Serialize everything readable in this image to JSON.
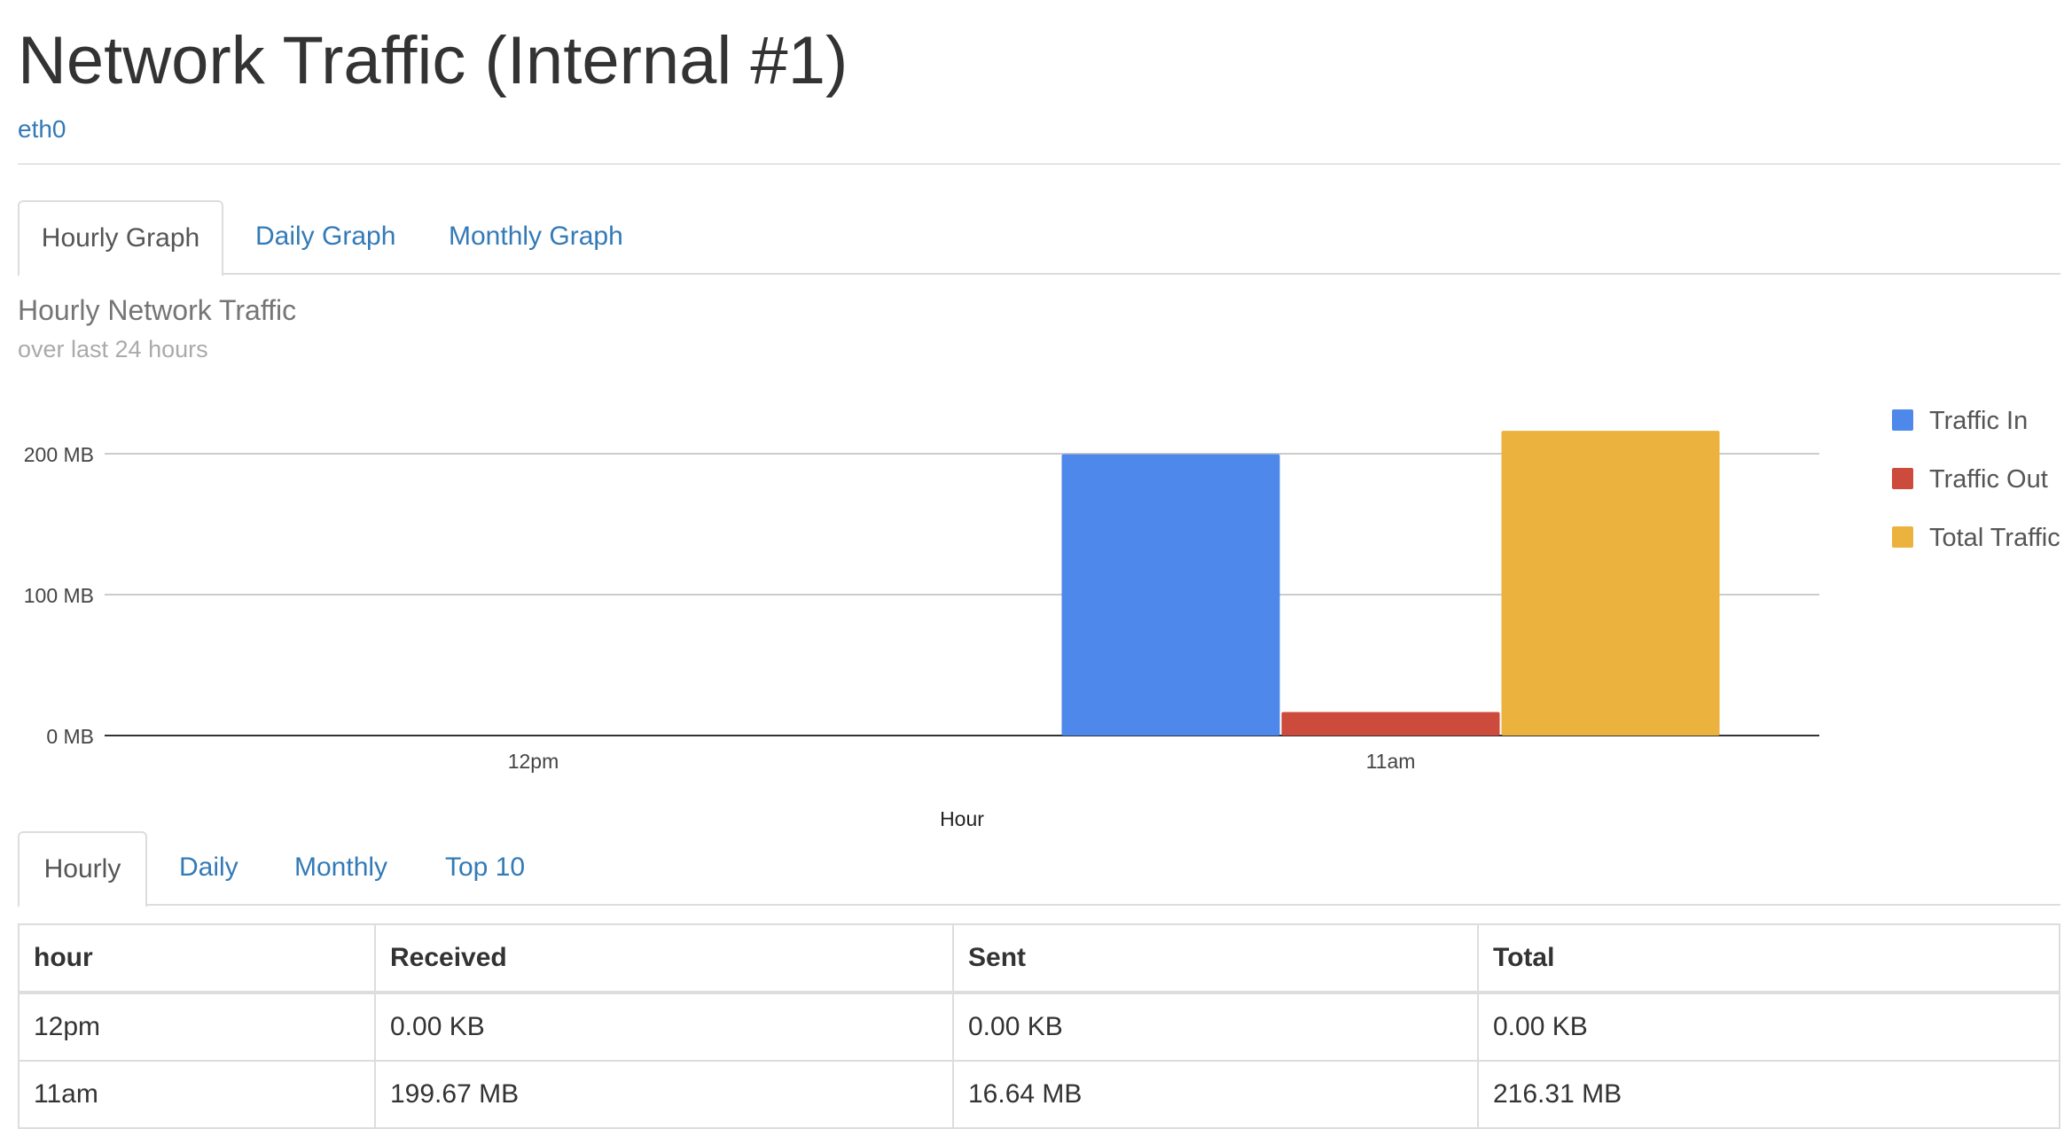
{
  "header": {
    "title": "Network Traffic (Internal #1)",
    "interface": "eth0"
  },
  "graph_tabs": [
    {
      "label": "Hourly Graph",
      "active": true
    },
    {
      "label": "Daily Graph",
      "active": false
    },
    {
      "label": "Monthly Graph",
      "active": false
    }
  ],
  "chart_data": {
    "type": "bar",
    "title": "Hourly Network Traffic",
    "subtitle": "over last 24 hours",
    "xlabel": "Hour",
    "ylabel": "",
    "categories": [
      "12pm",
      "11am"
    ],
    "series": [
      {
        "name": "Traffic In",
        "color": "#4e88ea",
        "values": [
          0,
          199.67
        ]
      },
      {
        "name": "Traffic Out",
        "color": "#cc4b3c",
        "values": [
          0,
          16.64
        ]
      },
      {
        "name": "Total Traffic",
        "color": "#ebb33e",
        "values": [
          0,
          216.31
        ]
      }
    ],
    "ylim": [
      0,
      200
    ],
    "yticks": [
      {
        "value": 0,
        "label": "0 MB"
      },
      {
        "value": 100,
        "label": "100 MB"
      },
      {
        "value": 200,
        "label": "200 MB"
      }
    ],
    "grid": true,
    "legend": "right"
  },
  "table_tabs": [
    {
      "label": "Hourly",
      "active": true
    },
    {
      "label": "Daily",
      "active": false
    },
    {
      "label": "Monthly",
      "active": false
    },
    {
      "label": "Top 10",
      "active": false
    }
  ],
  "table": {
    "columns": [
      "hour",
      "Received",
      "Sent",
      "Total"
    ],
    "rows": [
      [
        "12pm",
        "0.00 KB",
        "0.00 KB",
        "0.00 KB"
      ],
      [
        "11am",
        "199.67 MB",
        "16.64 MB",
        "216.31 MB"
      ]
    ]
  }
}
